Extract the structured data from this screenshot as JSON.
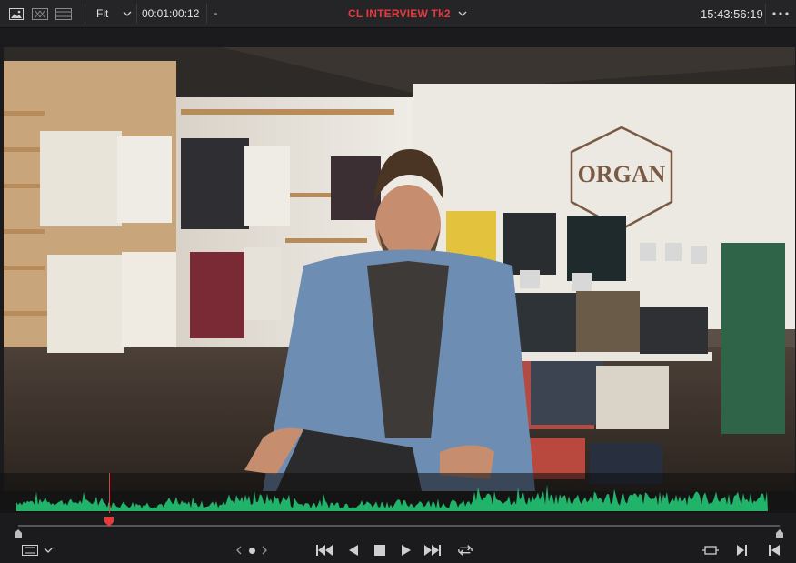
{
  "topbar": {
    "zoom_label": "Fit",
    "timecode_in": "00:01:00:12",
    "clip_title": "CL INTERVIEW Tk2",
    "timecode_out": "15:43:56:19"
  },
  "colors": {
    "accent_red": "#e8393d",
    "waveform_green": "#22b36a",
    "toolbar_bg": "#252528"
  },
  "viewer": {
    "sign_text": "ORGAN"
  },
  "scrubber": {
    "playhead_position": 0.122
  },
  "icons": {
    "view_single": "image-icon",
    "view_compare": "compare-icon",
    "view_film": "filmstrip-icon",
    "menu": "more-icon"
  }
}
